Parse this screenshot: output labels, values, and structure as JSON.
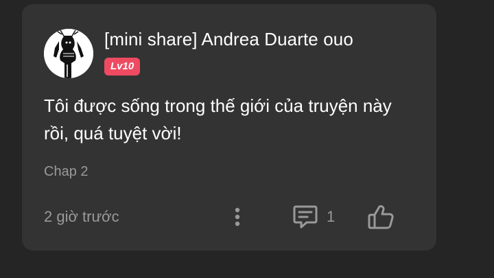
{
  "comment": {
    "username": "[mini share] Andrea Duarte ouo",
    "level_badge": "Lv10",
    "text": "Tôi được sống trong thế giới của truyện này rồi, quá tuyệt vời!",
    "chapter": "Chap 2",
    "timestamp": "2 giờ trước",
    "reply_count": "1",
    "icons": {
      "more": "more-vertical-icon",
      "reply": "comment-icon",
      "like": "thumbs-up-icon"
    },
    "colors": {
      "page_background": "#252525",
      "card_background": "#333333",
      "badge": "#ee4b62",
      "secondary_text": "#9a9a9a"
    }
  }
}
